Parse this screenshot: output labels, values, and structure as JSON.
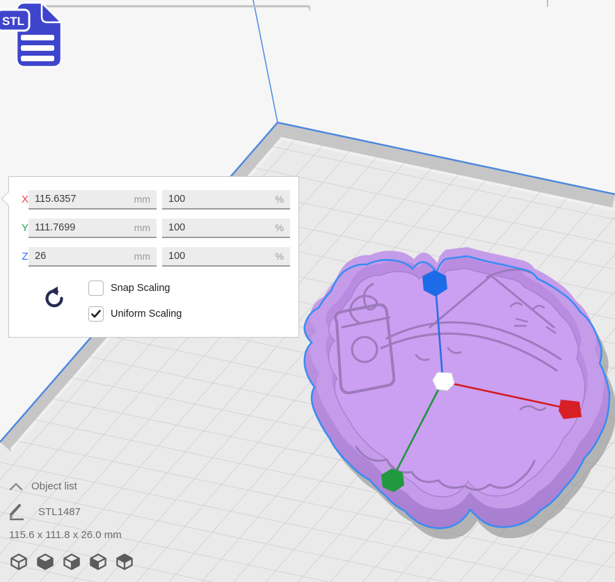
{
  "file_badge": {
    "label": "STL"
  },
  "scale_panel": {
    "rows": [
      {
        "axis": "X",
        "value": "115.6357",
        "unit": "mm",
        "percent": "100",
        "percent_unit": "%"
      },
      {
        "axis": "Y",
        "value": "111.7699",
        "unit": "mm",
        "percent": "100",
        "percent_unit": "%"
      },
      {
        "axis": "Z",
        "value": "26",
        "unit": "mm",
        "percent": "100",
        "percent_unit": "%"
      }
    ],
    "snap_label": "Snap Scaling",
    "snap_checked": false,
    "uniform_label": "Uniform Scaling",
    "uniform_checked": true
  },
  "object_panel": {
    "object_list_label": "Object list",
    "object_name": "STL1487",
    "dimensions": "115.6 x 111.8 x 26.0 mm"
  },
  "view_toolbar": {
    "buttons": [
      "view-3d",
      "view-front",
      "view-top",
      "view-left",
      "view-right"
    ]
  },
  "colors": {
    "axis_x": "#e8414d",
    "axis_y": "#1cab4a",
    "axis_z": "#2f6bff",
    "selection_outline": "#3b8cf2",
    "handle_x": "#d81f26",
    "handle_y": "#22993e",
    "handle_z": "#1d6be6",
    "model_purple": "#c59ce9",
    "plate_edge_blue": "#4b87dd",
    "stl_badge_blue": "#3e44cb"
  }
}
